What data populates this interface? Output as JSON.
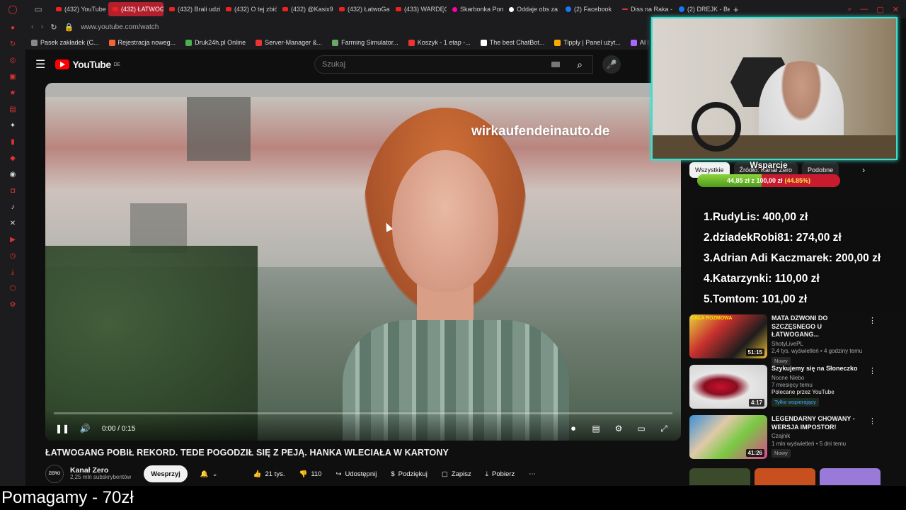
{
  "browser": {
    "tabs": [
      {
        "label": "(432) YouTube",
        "fav": "yt"
      },
      {
        "label": "(432) ŁATWOGANG P...",
        "fav": "yt",
        "active": true
      },
      {
        "label": "(432) Brali udzi...",
        "fav": "yt"
      },
      {
        "label": "(432) O tej zbió...",
        "fav": "yt"
      },
      {
        "label": "(432) @Kasix90",
        "fav": "yt"
      },
      {
        "label": "(432) ŁatwoGan",
        "fav": "yt"
      },
      {
        "label": "(433) WARDĘG",
        "fav": "yt"
      },
      {
        "label": "Skarbonka Pom",
        "fav": "pig"
      },
      {
        "label": "Oddaje obs za a",
        "fav": "tt"
      },
      {
        "label": "(2) Facebook",
        "fav": "fb"
      },
      {
        "label": "Diss na Raka - ",
        "fav": "dash"
      },
      {
        "label": "(2) DREJK - Beli",
        "fav": "fb"
      }
    ],
    "url": "www.youtube.com/watch",
    "bookmarks": [
      "Pasek zakładek (C...",
      "Rejestracja noweg...",
      "Druk24h.pl Online",
      "Server-Manager &...",
      "Farming Simulator...",
      "Koszyk - 1 etap -...",
      "The best ChatBot...",
      "Tipply | Panel użyt...",
      "AI Music Genera"
    ]
  },
  "youtube": {
    "logo": "YouTube",
    "region": "DE",
    "search_placeholder": "Szukaj"
  },
  "player": {
    "overlay_text": "wirkaufendeinauto.de",
    "time": "0:00 / 0:15",
    "progress_fraction": 0.0
  },
  "video": {
    "title": "ŁATWOGANG POBIŁ REKORD. TEDE POGODZIŁ SIĘ Z PEJĄ. HANKA WLECIAŁA W KARTONY",
    "channel_avatar": "ZERO",
    "channel_name": "Kanał Zero",
    "subscribers": "2,25 mln subskrybentów",
    "support_label": "Wesprzyj",
    "likes": "21 tys.",
    "dislikes": "110",
    "share_label": "Udostępnij",
    "thanks_label": "Podziękuj",
    "save_label": "Zapisz",
    "download_label": "Pobierz"
  },
  "recommendations": {
    "chips": [
      "Wszystkie",
      "Źródło: Kanał Zero",
      "Podobne"
    ],
    "items": [
      {
        "title": "MATA DZWONI DO SZCZĘSNEGO U ŁATWOGANG...",
        "channel": "ShotyLivePL",
        "meta": "2,4 tys. wyświetleń • 4 godziny temu",
        "badge": "Nowy",
        "duration": "51:15",
        "thumb_text": "CAŁA ROZMOWA"
      },
      {
        "title": "Szykujemy się na Słoneczko",
        "channel": "Nocne Niebo",
        "meta": "7 miesięcy temu",
        "extra": "Polecane przez YouTube",
        "badge": "Tylko wspierający",
        "duration": "4:17"
      },
      {
        "title": "LEGENDARNY CHOWANY - WERSJA IMPOSTOR!",
        "channel": "Czajnik",
        "meta": "1 mln wyświetleń • 5 dni temu",
        "badge": "Nowy",
        "duration": "41:26"
      }
    ]
  },
  "donation_widget": {
    "title": "Wsparcie",
    "raised": "44,85 zł",
    "goal_text": "z 100,00 zł",
    "percent_text": "(44.85%)",
    "fraction": 0.4485,
    "colors": {
      "fill": "#6fbf2a",
      "empty": "#c81c2e"
    }
  },
  "top_donors": [
    "1.RudyLis: 400,00 zł",
    "2.dziadekRobi81: 274,00 zł",
    "3.Adrian Adi Kaczmarek: 200,00 zł",
    "4.Katarzynki: 110,00 zł",
    "5.Tomtom: 101,00 zł"
  ],
  "stream_banner": "Pomagamy - 70zł",
  "icons": {
    "menu": "☰",
    "search": "⌕",
    "mic": "🎤",
    "pause": "❚❚",
    "volume": "🔊",
    "like": "👍",
    "dislike": "👎",
    "share": "↪",
    "thanks": "$",
    "save": "▢",
    "download": "⤓",
    "more": "⋯",
    "bell": "🔔",
    "chevron_down": "⌄",
    "kebab": "⋮",
    "chevron_right": "›"
  }
}
